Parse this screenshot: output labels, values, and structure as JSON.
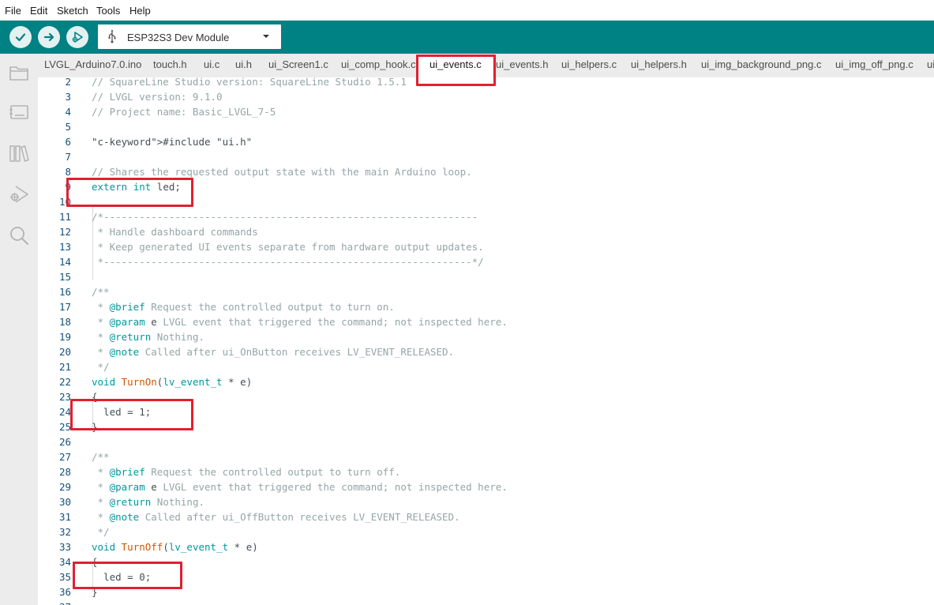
{
  "menu": [
    "File",
    "Edit",
    "Sketch",
    "Tools",
    "Help"
  ],
  "toolbar": {
    "verify_icon": "check-icon",
    "upload_icon": "arrow-right-icon",
    "debug_icon": "debug-play-icon",
    "board": "ESP32S3 Dev Module",
    "board_icon": "usb-icon",
    "accent": "#008184"
  },
  "sidebar": [
    "folder-icon",
    "board-icon",
    "library-icon",
    "debug-icon",
    "search-icon"
  ],
  "tabs": [
    {
      "label": "LVGL_Arduino7.0.ino",
      "active": false
    },
    {
      "label": "touch.h",
      "active": false
    },
    {
      "label": "ui.c",
      "active": false
    },
    {
      "label": "ui.h",
      "active": false
    },
    {
      "label": "ui_Screen1.c",
      "active": false
    },
    {
      "label": "ui_comp_hook.c",
      "active": false
    },
    {
      "label": "ui_events.c",
      "active": true
    },
    {
      "label": "ui_events.h",
      "active": false
    },
    {
      "label": "ui_helpers.c",
      "active": false
    },
    {
      "label": "ui_helpers.h",
      "active": false
    },
    {
      "label": "ui_img_background_png.c",
      "active": false
    },
    {
      "label": "ui_img_off_png.c",
      "active": false
    },
    {
      "label": "ui",
      "active": false
    }
  ],
  "code": {
    "first_line": 2,
    "lines": [
      "// SquareLine Studio version: SquareLine Studio 1.5.1",
      "// LVGL version: 9.1.0",
      "// Project name: Basic_LVGL_7-5",
      "",
      "#include \"ui.h\"",
      "",
      "// Shares the requested output state with the main Arduino loop.",
      "extern int led;",
      "",
      "/*---------------------------------------------------------------",
      " * Handle dashboard commands",
      " * Keep generated UI events separate from hardware output updates.",
      " *--------------------------------------------------------------*/",
      "",
      "/**",
      " * @brief Request the controlled output to turn on.",
      " * @param e LVGL event that triggered the command; not inspected here.",
      " * @return Nothing.",
      " * @note Called after ui_OnButton receives LV_EVENT_RELEASED.",
      " */",
      "void TurnOn(lv_event_t * e)",
      "{",
      "  led = 1;",
      "}",
      "",
      "/**",
      " * @brief Request the controlled output to turn off.",
      " * @param e LVGL event that triggered the command; not inspected here.",
      " * @return Nothing.",
      " * @note Called after ui_OffButton receives LV_EVENT_RELEASED.",
      " */",
      "void TurnOff(lv_event_t * e)",
      "{",
      "  led = 0;",
      "}",
      ""
    ]
  },
  "annotation_color": "#e02030"
}
